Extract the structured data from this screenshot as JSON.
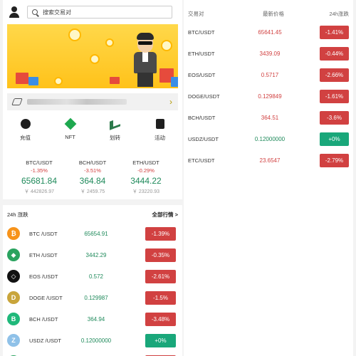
{
  "header": {
    "search_placeholder": "搜索交易对"
  },
  "actions": [
    {
      "label": "充值",
      "icon": "deposit-icon"
    },
    {
      "label": "NFT",
      "icon": "nft-icon"
    },
    {
      "label": "划转",
      "icon": "transfer-icon"
    },
    {
      "label": "活动",
      "icon": "activity-icon"
    }
  ],
  "tickers": [
    {
      "pair": "BTC/USDT",
      "pct": "-1.35%",
      "price": "65681.84",
      "cny": "￥ 442826.97"
    },
    {
      "pair": "BCH/USDT",
      "pct": "-3.51%",
      "price": "364.84",
      "cny": "￥ 2459.75"
    },
    {
      "pair": "ETH/USDT",
      "pct": "-0.29%",
      "price": "3444.22",
      "cny": "￥ 23220.93"
    }
  ],
  "market": {
    "title": "24h 涨跌",
    "all_label": "全部行情 >",
    "rows": [
      {
        "name": "BTC /USDT",
        "price": "65654.91",
        "change": "-1.39%",
        "dir": "down",
        "logo": "btc-logo",
        "color": "#f7931a",
        "glyph": "₿"
      },
      {
        "name": "ETH /USDT",
        "price": "3442.29",
        "change": "-0.35%",
        "dir": "down",
        "logo": "eth-logo",
        "color": "#2aa35f",
        "glyph": "◆"
      },
      {
        "name": "EOS /USDT",
        "price": "0.572",
        "change": "-2.61%",
        "dir": "down",
        "logo": "eos-logo",
        "color": "#111111",
        "glyph": "◇"
      },
      {
        "name": "DOGE /USDT",
        "price": "0.129987",
        "change": "-1.5%",
        "dir": "down",
        "logo": "doge-logo",
        "color": "#c9a53b",
        "glyph": "D"
      },
      {
        "name": "BCH /USDT",
        "price": "364.94",
        "change": "-3.48%",
        "dir": "down",
        "logo": "bch-logo",
        "color": "#1fb87a",
        "glyph": "B"
      },
      {
        "name": "USDZ /USDT",
        "price": "0.12000000",
        "change": "+0%",
        "dir": "up",
        "logo": "usdz-logo",
        "color": "#8fc1e8",
        "glyph": "Z"
      },
      {
        "name": "ETC /USDT",
        "price": "23.6879",
        "change": "-2.66%",
        "dir": "down",
        "logo": "etc-logo",
        "color": "#2aa35f",
        "glyph": "◆"
      }
    ]
  },
  "right": {
    "headers": {
      "pair": "交易对",
      "price": "最新价格",
      "change": "24h涨跌"
    },
    "rows": [
      {
        "pair": "BTC/USDT",
        "price": "65641.45",
        "change": "-1.41%",
        "dir": "down"
      },
      {
        "pair": "ETH/USDT",
        "price": "3439.09",
        "change": "-0.44%",
        "dir": "down"
      },
      {
        "pair": "EOS/USDT",
        "price": "0.5717",
        "change": "-2.66%",
        "dir": "down"
      },
      {
        "pair": "DOGE/USDT",
        "price": "0.129849",
        "change": "-1.61%",
        "dir": "down"
      },
      {
        "pair": "BCH/USDT",
        "price": "364.51",
        "change": "-3.6%",
        "dir": "down"
      },
      {
        "pair": "USDZ/USDT",
        "price": "0.12000000",
        "change": "+0%",
        "dir": "up"
      },
      {
        "pair": "ETC/USDT",
        "price": "23.6547",
        "change": "-2.79%",
        "dir": "down"
      }
    ]
  },
  "colors": {
    "down": "#d14141",
    "up": "#19a77a",
    "price_green": "#1f8a5b",
    "banner": "#ffc21a"
  }
}
